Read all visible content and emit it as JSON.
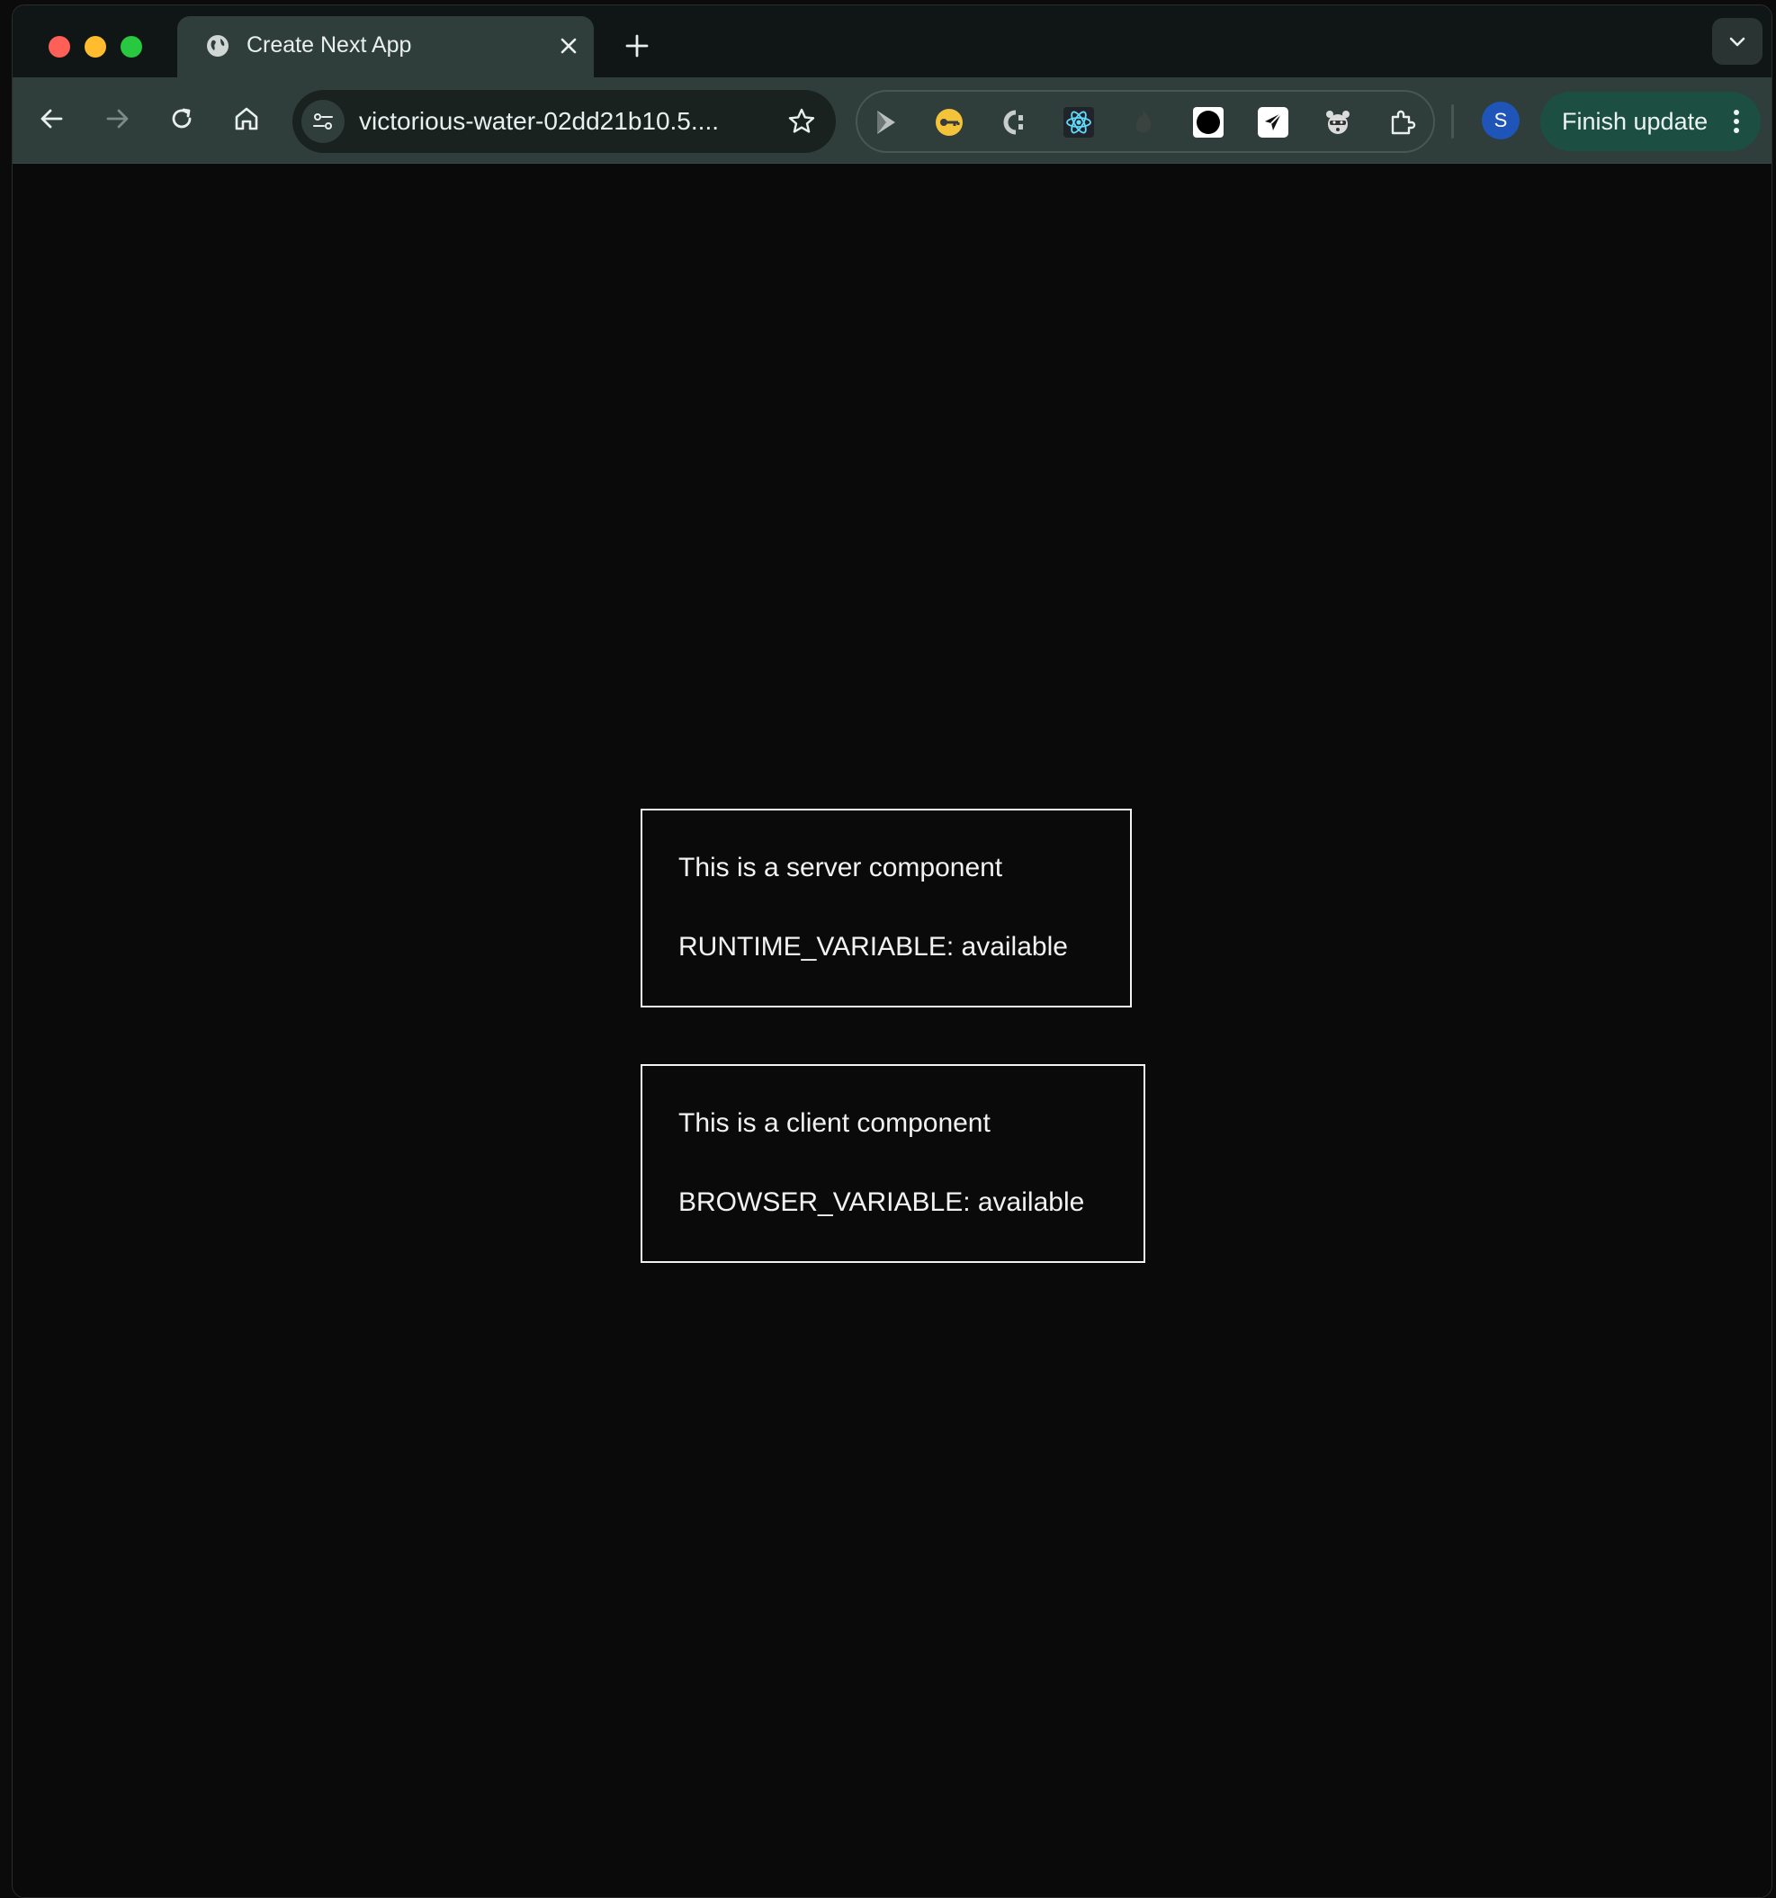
{
  "browser": {
    "tab": {
      "title": "Create Next App"
    },
    "address_bar": {
      "url": "victorious-water-02dd21b10.5...."
    },
    "profile": {
      "initial": "S"
    },
    "update_button": {
      "label": "Finish update"
    },
    "extensions": [
      "play-extension-icon",
      "key-extension-icon",
      "c-extension-icon",
      "react-devtools-icon",
      "flame-extension-icon",
      "circle-extension-icon",
      "send-extension-icon",
      "raccoon-extension-icon",
      "puzzle-extensions-icon"
    ]
  },
  "page": {
    "server_component": {
      "heading": "This is a server component",
      "variable": "RUNTIME_VARIABLE: available"
    },
    "client_component": {
      "heading": "This is a client component",
      "variable": "BROWSER_VARIABLE: available"
    }
  },
  "colors": {
    "page_background": "#0a0a0a",
    "card_border": "#f2f2f2",
    "chrome_toolbar": "#2f3d3b",
    "update_button": "#1c4f42",
    "avatar": "#1f55b8"
  }
}
